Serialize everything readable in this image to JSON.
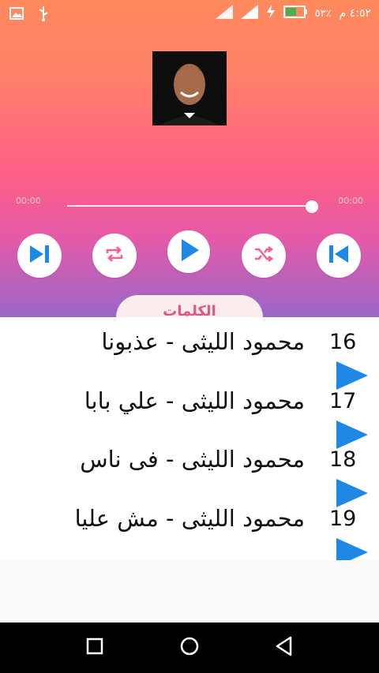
{
  "status_bar": {
    "time": "٤:٥٢ م",
    "battery": "٥٣٪",
    "icons": [
      "image-icon",
      "usb-icon",
      "signal-icon",
      "signal-icon",
      "charging-icon",
      "battery-icon"
    ]
  },
  "player": {
    "time_elapsed": "00:00",
    "time_total": "00:00",
    "progress": 1.0,
    "controls": [
      "next-icon",
      "repeat-icon",
      "play-icon",
      "shuffle-icon",
      "previous-icon"
    ],
    "lyrics_label": "الكلمات",
    "accent_color": "#1e88e5"
  },
  "songs": [
    {
      "number": "16",
      "title": "محمود الليثى - عذبونا"
    },
    {
      "number": "17",
      "title": "محمود الليثى - علي بابا"
    },
    {
      "number": "18",
      "title": "محمود الليثى - فى ناس"
    },
    {
      "number": "19",
      "title": "محمود الليثى - مش عليا"
    }
  ],
  "navigation": [
    "recents-icon",
    "home-icon",
    "back-icon"
  ]
}
